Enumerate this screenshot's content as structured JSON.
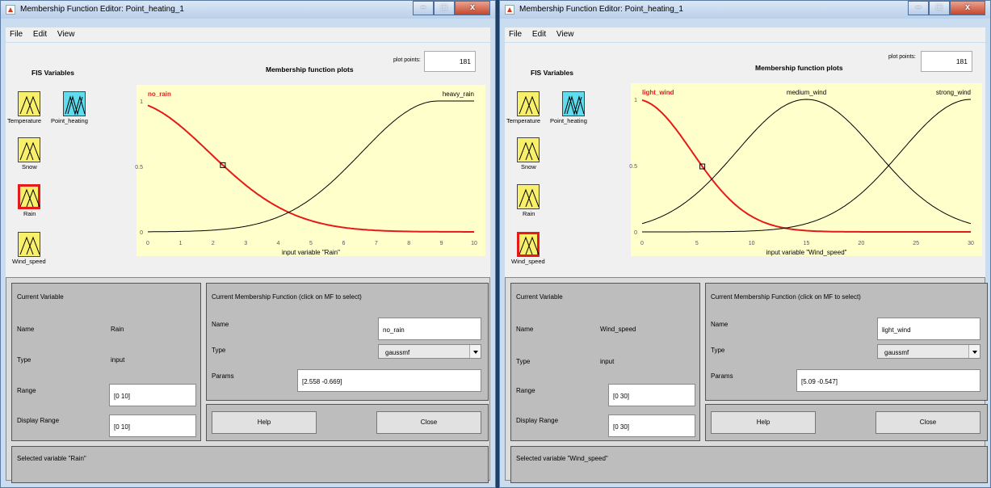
{
  "left": {
    "window_title": "Membership Function Editor: Point_heating_1",
    "menu": [
      "File",
      "Edit",
      "View"
    ],
    "fis_header": "FIS Variables",
    "variables": [
      "Temperature",
      "Point_heating",
      "Snow",
      "Rain",
      "Wind_speed"
    ],
    "selected_variable_index": 3,
    "plot": {
      "title": "Membership function plots",
      "plot_points_label": "plot points:",
      "plot_points_value": "181",
      "xlabel": "input variable \"Rain\"",
      "x_range": [
        0,
        10
      ],
      "x_ticks": [
        "0",
        "1",
        "2",
        "3",
        "4",
        "5",
        "6",
        "7",
        "8",
        "9",
        "10"
      ],
      "y_ticks": [
        "0",
        "0.5",
        "1"
      ],
      "mf_labels": [
        "no_rain",
        "heavy_rain"
      ],
      "selected_mf": "no_rain"
    },
    "current_variable": {
      "header": "Current Variable",
      "name_label": "Name",
      "name_value": "Rain",
      "type_label": "Type",
      "type_value": "input",
      "range_label": "Range",
      "range_value": "[0 10]",
      "display_range_label": "Display Range",
      "display_range_value": "[0 10]"
    },
    "current_mf": {
      "header": "Current Membership Function (click on MF to select)",
      "name_label": "Name",
      "name_value": "no_rain",
      "type_label": "Type",
      "type_value": "gaussmf",
      "params_label": "Params",
      "params_value": "[2.558 -0.669]"
    },
    "help_label": "Help",
    "close_label": "Close",
    "status": "Selected variable \"Rain\""
  },
  "right": {
    "window_title": "Membership Function Editor: Point_heating_1",
    "menu": [
      "File",
      "Edit",
      "View"
    ],
    "fis_header": "FIS Variables",
    "variables": [
      "Temperature",
      "Point_heating",
      "Snow",
      "Rain",
      "Wind_speed"
    ],
    "selected_variable_index": 4,
    "plot": {
      "title": "Membership function plots",
      "plot_points_label": "plot points:",
      "plot_points_value": "181",
      "xlabel": "input variable \"Wind_speed\"",
      "x_range": [
        0,
        30
      ],
      "x_ticks": [
        "0",
        "5",
        "10",
        "15",
        "20",
        "25",
        "30"
      ],
      "y_ticks": [
        "0",
        "0.5",
        "1"
      ],
      "mf_labels": [
        "light_wind",
        "medium_wind",
        "strong_wind"
      ],
      "selected_mf": "light_wind"
    },
    "current_variable": {
      "header": "Current Variable",
      "name_label": "Name",
      "name_value": "Wind_speed",
      "type_label": "Type",
      "type_value": "input",
      "range_label": "Range",
      "range_value": "[0 30]",
      "display_range_label": "Display Range",
      "display_range_value": "[0 30]"
    },
    "current_mf": {
      "header": "Current Membership Function (click on MF to select)",
      "name_label": "Name",
      "name_value": "light_wind",
      "type_label": "Type",
      "type_value": "gaussmf",
      "params_label": "Params",
      "params_value": "[5.09 -0.547]"
    },
    "help_label": "Help",
    "close_label": "Close",
    "status": "Selected variable \"Wind_speed\""
  },
  "colors": {
    "plot_bg": "#ffffcc",
    "selected_curve": "#e51a1a",
    "curve": "#000000",
    "input_icon": "#f8f06a",
    "output_icon": "#5fdcee"
  }
}
